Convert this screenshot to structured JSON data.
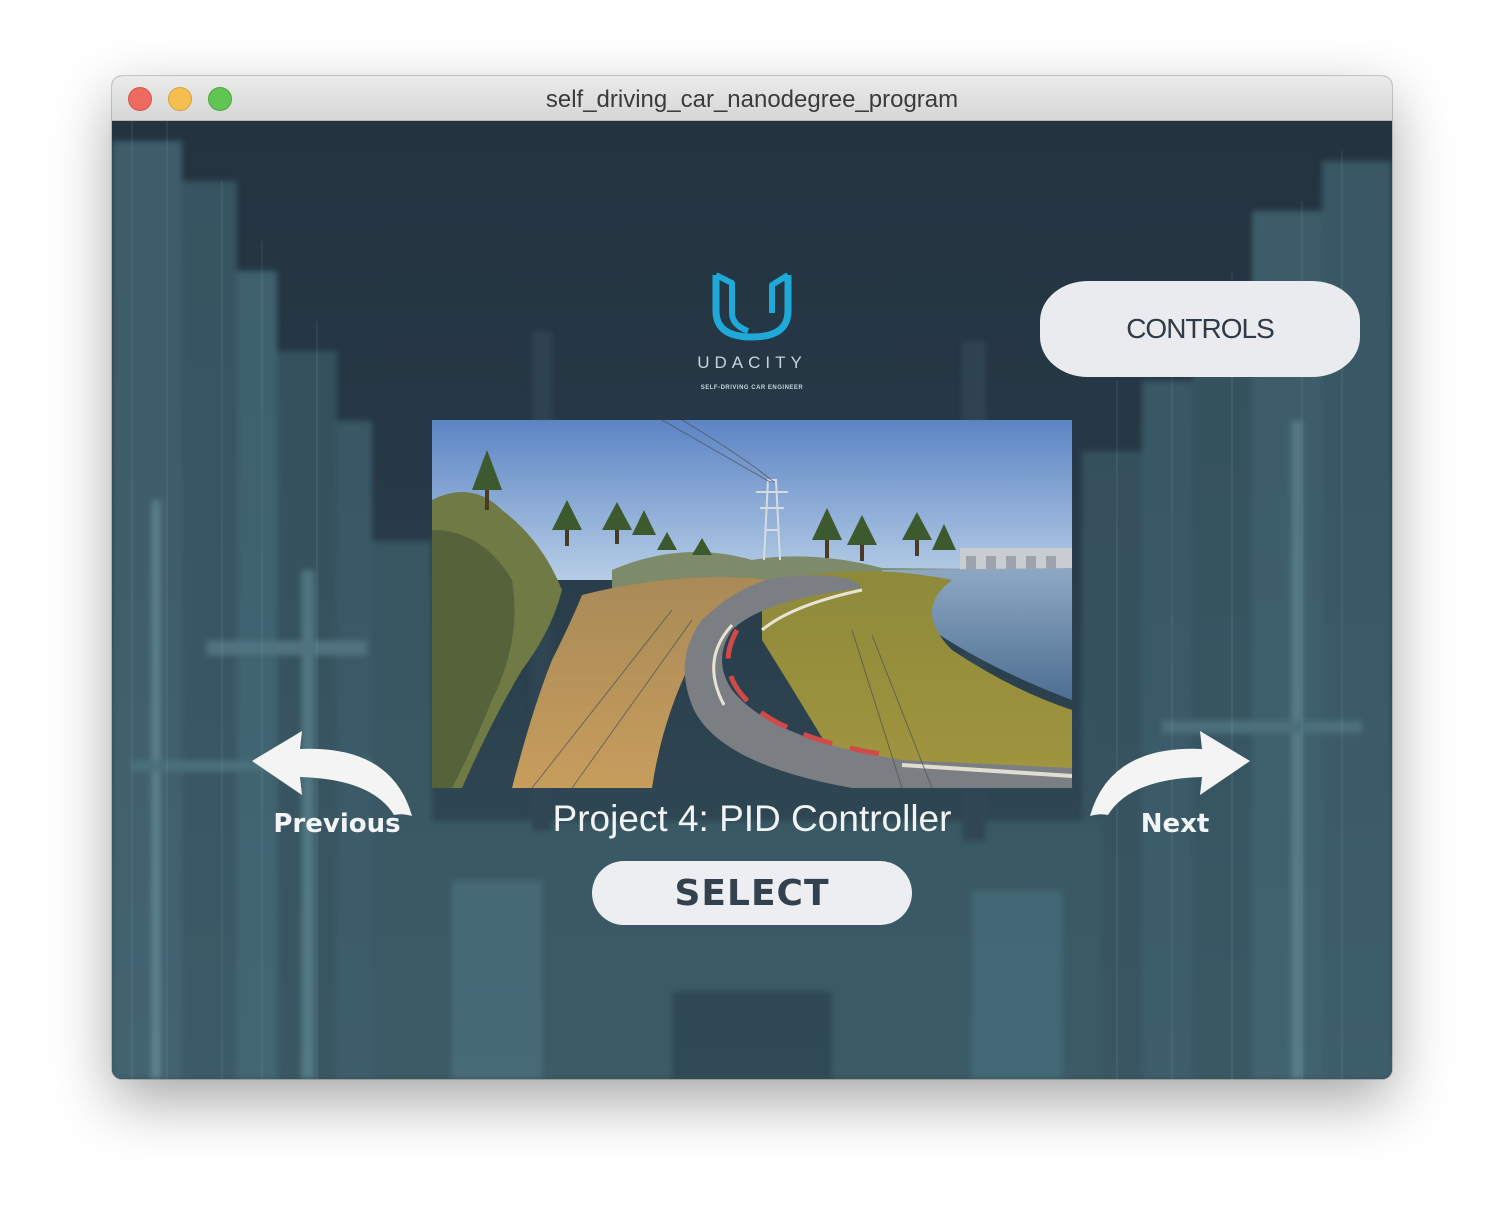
{
  "window": {
    "title": "self_driving_car_nanodegree_program"
  },
  "logo": {
    "wordmark": "UDACITY",
    "tagline": "SELF-DRIVING CAR ENGINEER",
    "icon": "udacity-u-logo"
  },
  "controls_button": {
    "label": "CONTROLS"
  },
  "carousel": {
    "project_title": "Project 4: PID Controller",
    "previous_label": "Previous",
    "next_label": "Next",
    "select_label": "SELECT",
    "preview_image": "lake-track-preview"
  },
  "colors": {
    "background": "#24323f",
    "logo_accent": "#1ea9d8",
    "button_fill": "#e9ebef",
    "button_text": "#2f3b47"
  }
}
